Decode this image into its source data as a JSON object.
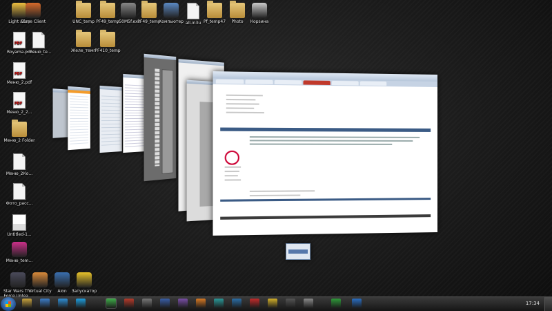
{
  "desktop": {
    "icons": [
      {
        "label": "Light Alloy",
        "type": "app",
        "color": "#f0c040"
      },
      {
        "label": "Curse Client",
        "type": "app",
        "color": "#d96b2b"
      },
      {
        "label": "UNC_temp",
        "type": "folder"
      },
      {
        "label": "PF49_temp",
        "type": "folder"
      },
      {
        "label": "y50M5f.exe",
        "type": "app",
        "color": "#888888"
      },
      {
        "label": "PF49_temp",
        "type": "folder"
      },
      {
        "label": "Компьютер",
        "type": "app",
        "color": "#5b8ac4"
      },
      {
        "label": "all-in3u",
        "type": "doc"
      },
      {
        "label": "Pf_temp47",
        "type": "folder"
      },
      {
        "label": "Photo",
        "type": "folder"
      },
      {
        "label": "Корзина",
        "type": "app",
        "color": "#cccccc"
      },
      {
        "label": "Royama.pdf",
        "type": "pdf"
      },
      {
        "label": "~меню_te...",
        "type": "doc"
      },
      {
        "label": "Желе_темп",
        "type": "folder"
      },
      {
        "label": "PF410_temp",
        "type": "folder"
      },
      {
        "label": "Меню_2.pdf",
        "type": "pdf"
      },
      {
        "label": "Меню_2_2...",
        "type": "pdf"
      },
      {
        "label": "Меню_2 Folder",
        "type": "folder"
      },
      {
        "label": "Меню_2Ко...",
        "type": "doc"
      },
      {
        "label": "Фото_расс...",
        "type": "doc"
      },
      {
        "label": "Untitled-1...",
        "type": "png"
      },
      {
        "label": "Меню_tem...",
        "type": "app",
        "color": "#cc2f8a"
      },
      {
        "label": "Star Wars The Force Unlea...",
        "type": "app",
        "color": "#4a4a5a"
      },
      {
        "label": "Virtual City",
        "type": "app",
        "color": "#d98a3a"
      },
      {
        "label": "Aion",
        "type": "app",
        "color": "#3a6fb0"
      },
      {
        "label": "Запускатор",
        "type": "app",
        "color": "#e8c22a"
      }
    ]
  },
  "taskbar": {
    "clock": "17:34",
    "buttons": [
      {
        "name": "explorer",
        "color": "#c9a43e"
      },
      {
        "name": "media",
        "color": "#3d7ec9"
      },
      {
        "name": "browser-1",
        "color": "#2f8fd6"
      },
      {
        "name": "skype",
        "color": "#1fa0e0"
      },
      {
        "name": "app-green",
        "color": "#3fae49",
        "active": true
      },
      {
        "name": "app-red",
        "color": "#b83b2b"
      },
      {
        "name": "app-gray",
        "color": "#777777"
      },
      {
        "name": "app-blue",
        "color": "#3a5fa8"
      },
      {
        "name": "app-purple",
        "color": "#7a4fa8"
      },
      {
        "name": "app-orange",
        "color": "#d97a24"
      },
      {
        "name": "app-teal",
        "color": "#2b9a9a"
      },
      {
        "name": "photoshop",
        "color": "#2b6fa8"
      },
      {
        "name": "app-red-2",
        "color": "#c42b2b"
      },
      {
        "name": "app-yellow",
        "color": "#d4b02a"
      },
      {
        "name": "app-dark",
        "color": "#555555"
      },
      {
        "name": "app-gray-2",
        "color": "#8a8a8a"
      },
      {
        "name": "app-green-2",
        "color": "#2f9c3a"
      },
      {
        "name": "app-blue-2",
        "color": "#2a6fc4"
      }
    ]
  }
}
